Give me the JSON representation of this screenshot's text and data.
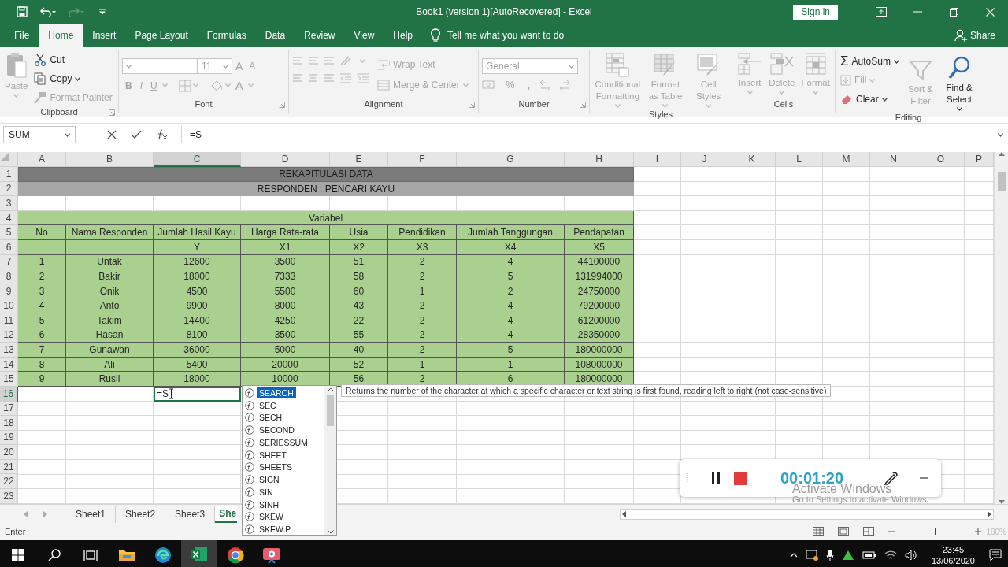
{
  "window": {
    "title": "Book1 (version 1)[AutoRecovered]  -  Excel",
    "sign_in": "Sign in"
  },
  "menu_tabs": [
    {
      "label": "File",
      "selected": false
    },
    {
      "label": "Home",
      "selected": true
    },
    {
      "label": "Insert",
      "selected": false
    },
    {
      "label": "Page Layout",
      "selected": false
    },
    {
      "label": "Formulas",
      "selected": false
    },
    {
      "label": "Data",
      "selected": false
    },
    {
      "label": "Review",
      "selected": false
    },
    {
      "label": "View",
      "selected": false
    },
    {
      "label": "Help",
      "selected": false
    }
  ],
  "tell_me": "Tell me what you want to do",
  "share": "Share",
  "ribbon": {
    "clipboard": {
      "title": "Clipboard",
      "paste": {
        "label": "Paste",
        "disabled": true
      },
      "cut": {
        "label": "Cut",
        "disabled": false
      },
      "copy": {
        "label": "Copy",
        "disabled": false
      },
      "format_painter": {
        "label": "Format Painter",
        "disabled": true
      }
    },
    "font": {
      "title": "Font",
      "disabled": true,
      "size": "11",
      "grow": "A",
      "shrink": "A",
      "styles": [
        "B",
        "I",
        "U"
      ],
      "font_color": "A"
    },
    "alignment": {
      "title": "Alignment",
      "disabled": true,
      "wrap_text": "Wrap Text",
      "merge": "Merge & Center"
    },
    "number": {
      "title": "Number",
      "disabled": true,
      "format": "General",
      "percent": "%",
      "comma": ","
    },
    "styles": {
      "title": "Styles",
      "disabled": true,
      "buttons": [
        "Conditional Formatting",
        "Format as Table",
        "Cell Styles"
      ]
    },
    "cells": {
      "title": "Cells",
      "disabled": true,
      "buttons": [
        "Insert",
        "Delete",
        "Format"
      ]
    },
    "editing": {
      "title": "Editing",
      "autosum": {
        "sigma": "Σ",
        "label": "AutoSum",
        "disabled": false
      },
      "fill": {
        "label": "Fill",
        "disabled": true
      },
      "clear": {
        "label": "Clear",
        "disabled": false
      },
      "sort": {
        "label": "Sort & Filter",
        "disabled": true
      },
      "find": {
        "label": "Find & Select",
        "disabled": false
      }
    }
  },
  "formula_bar": {
    "name_box": "SUM",
    "formula": "=S"
  },
  "sheet": {
    "columns": [
      {
        "label": "A",
        "selected": false
      },
      {
        "label": "B",
        "selected": false
      },
      {
        "label": "C",
        "selected": true
      },
      {
        "label": "D",
        "selected": false
      },
      {
        "label": "E",
        "selected": false
      },
      {
        "label": "F",
        "selected": false
      },
      {
        "label": "G",
        "selected": false
      },
      {
        "label": "H",
        "selected": false
      },
      {
        "label": "I",
        "selected": false
      },
      {
        "label": "J",
        "selected": false
      },
      {
        "label": "K",
        "selected": false
      },
      {
        "label": "L",
        "selected": false
      },
      {
        "label": "M",
        "selected": false
      },
      {
        "label": "N",
        "selected": false
      },
      {
        "label": "O",
        "selected": false
      },
      {
        "label": "P",
        "selected": false
      }
    ],
    "rows": [
      {
        "number": "1",
        "selected": false,
        "kind": "title",
        "text": "REKAPITULASI DATA"
      },
      {
        "number": "2",
        "selected": false,
        "kind": "subtitle",
        "text": "RESPONDEN : PENCARI KAYU"
      },
      {
        "number": "3",
        "selected": false,
        "kind": "plain"
      },
      {
        "number": "4",
        "selected": false,
        "kind": "group",
        "text": "Variabel"
      },
      {
        "number": "5",
        "selected": false,
        "kind": "table",
        "cells": [
          "No",
          "Nama Responden",
          "Jumlah Hasil Kayu",
          "Harga Rata-rata",
          "Usia",
          "Pendidikan",
          "Jumlah Tanggungan",
          "Pendapatan"
        ]
      },
      {
        "number": "6",
        "selected": false,
        "kind": "table",
        "cells": [
          null,
          null,
          "Y",
          "X1",
          "X2",
          "X3",
          "X4",
          "X5"
        ]
      },
      {
        "number": "7",
        "selected": false,
        "kind": "table",
        "cells": [
          "1",
          "Untak",
          "12600",
          "3500",
          "51",
          "2",
          "4",
          "44100000"
        ]
      },
      {
        "number": "8",
        "selected": false,
        "kind": "table",
        "cells": [
          "2",
          "Bakir",
          "18000",
          "7333",
          "58",
          "2",
          "5",
          "131994000"
        ]
      },
      {
        "number": "9",
        "selected": false,
        "kind": "table",
        "cells": [
          "3",
          "Onik",
          "4500",
          "5500",
          "60",
          "1",
          "2",
          "24750000"
        ]
      },
      {
        "number": "10",
        "selected": false,
        "kind": "table",
        "cells": [
          "4",
          "Anto",
          "9900",
          "8000",
          "43",
          "2",
          "4",
          "79200000"
        ]
      },
      {
        "number": "11",
        "selected": false,
        "kind": "table",
        "cells": [
          "5",
          "Takim",
          "14400",
          "4250",
          "22",
          "2",
          "4",
          "61200000"
        ]
      },
      {
        "number": "12",
        "selected": false,
        "kind": "table",
        "cells": [
          "6",
          "Hasan",
          "8100",
          "3500",
          "55",
          "2",
          "4",
          "28350000"
        ]
      },
      {
        "number": "13",
        "selected": false,
        "kind": "table",
        "cells": [
          "7",
          "Gunawan",
          "36000",
          "5000",
          "40",
          "2",
          "5",
          "180000000"
        ]
      },
      {
        "number": "14",
        "selected": false,
        "kind": "table",
        "cells": [
          "8",
          "Ali",
          "5400",
          "20000",
          "52",
          "1",
          "1",
          "108000000"
        ]
      },
      {
        "number": "15",
        "selected": false,
        "kind": "table",
        "cells": [
          "9",
          "Rusli",
          "18000",
          "10000",
          "56",
          "2",
          "6",
          "180000000"
        ]
      },
      {
        "number": "16",
        "selected": true,
        "kind": "editing",
        "cells": [
          null,
          null,
          "=S"
        ]
      },
      {
        "number": "17",
        "selected": false,
        "kind": "plain"
      },
      {
        "number": "18",
        "selected": false,
        "kind": "plain"
      },
      {
        "number": "19",
        "selected": false,
        "kind": "plain"
      },
      {
        "number": "20",
        "selected": false,
        "kind": "plain"
      },
      {
        "number": "21",
        "selected": false,
        "kind": "plain"
      },
      {
        "number": "22",
        "selected": false,
        "kind": "plain"
      },
      {
        "number": "23",
        "selected": false,
        "kind": "plain"
      }
    ]
  },
  "autocomplete": {
    "items": [
      {
        "label": "SEARCH",
        "selected": true
      },
      {
        "label": "SEC",
        "selected": false
      },
      {
        "label": "SECH",
        "selected": false
      },
      {
        "label": "SECOND",
        "selected": false
      },
      {
        "label": "SERIESSUM",
        "selected": false
      },
      {
        "label": "SHEET",
        "selected": false
      },
      {
        "label": "SHEETS",
        "selected": false
      },
      {
        "label": "SIGN",
        "selected": false
      },
      {
        "label": "SIN",
        "selected": false
      },
      {
        "label": "SINH",
        "selected": false
      },
      {
        "label": "SKEW",
        "selected": false
      },
      {
        "label": "SKEW.P",
        "selected": false
      }
    ],
    "tooltip": "Returns the number of the character at which a specific character or text string is first found, reading left to right (not case-sensitive)"
  },
  "sheet_tabs": [
    {
      "label": "Sheet1",
      "selected": false
    },
    {
      "label": "Sheet2",
      "selected": false
    },
    {
      "label": "Sheet3",
      "selected": false
    },
    {
      "label": "She",
      "selected": true
    }
  ],
  "status_bar": {
    "mode": "Enter",
    "zoom": {
      "level": 0.5,
      "reading": "100%"
    }
  },
  "recorder": {
    "time": "00:01:20"
  },
  "activation": {
    "title": "Activate Windows",
    "detail": "Go to Settings to activate Windows."
  },
  "taskbar": {
    "apps": [
      {
        "kind": "folder",
        "selected": false
      },
      {
        "kind": "edge",
        "selected": false
      },
      {
        "kind": "excel",
        "selected": true
      },
      {
        "kind": "chrome",
        "selected": false
      },
      {
        "kind": "recorder",
        "selected": false
      }
    ],
    "time": "23:45",
    "date": "13/06/2020"
  }
}
